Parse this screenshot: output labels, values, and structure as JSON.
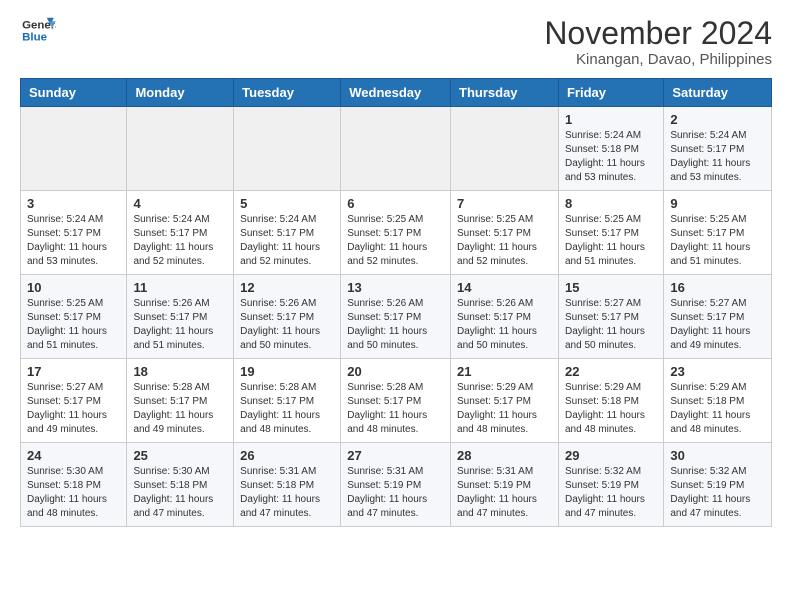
{
  "logo": {
    "line1": "General",
    "line2": "Blue"
  },
  "title": "November 2024",
  "subtitle": "Kinangan, Davao, Philippines",
  "days_of_week": [
    "Sunday",
    "Monday",
    "Tuesday",
    "Wednesday",
    "Thursday",
    "Friday",
    "Saturday"
  ],
  "weeks": [
    [
      {
        "day": "",
        "info": ""
      },
      {
        "day": "",
        "info": ""
      },
      {
        "day": "",
        "info": ""
      },
      {
        "day": "",
        "info": ""
      },
      {
        "day": "",
        "info": ""
      },
      {
        "day": "1",
        "info": "Sunrise: 5:24 AM\nSunset: 5:18 PM\nDaylight: 11 hours\nand 53 minutes."
      },
      {
        "day": "2",
        "info": "Sunrise: 5:24 AM\nSunset: 5:17 PM\nDaylight: 11 hours\nand 53 minutes."
      }
    ],
    [
      {
        "day": "3",
        "info": "Sunrise: 5:24 AM\nSunset: 5:17 PM\nDaylight: 11 hours\nand 53 minutes."
      },
      {
        "day": "4",
        "info": "Sunrise: 5:24 AM\nSunset: 5:17 PM\nDaylight: 11 hours\nand 52 minutes."
      },
      {
        "day": "5",
        "info": "Sunrise: 5:24 AM\nSunset: 5:17 PM\nDaylight: 11 hours\nand 52 minutes."
      },
      {
        "day": "6",
        "info": "Sunrise: 5:25 AM\nSunset: 5:17 PM\nDaylight: 11 hours\nand 52 minutes."
      },
      {
        "day": "7",
        "info": "Sunrise: 5:25 AM\nSunset: 5:17 PM\nDaylight: 11 hours\nand 52 minutes."
      },
      {
        "day": "8",
        "info": "Sunrise: 5:25 AM\nSunset: 5:17 PM\nDaylight: 11 hours\nand 51 minutes."
      },
      {
        "day": "9",
        "info": "Sunrise: 5:25 AM\nSunset: 5:17 PM\nDaylight: 11 hours\nand 51 minutes."
      }
    ],
    [
      {
        "day": "10",
        "info": "Sunrise: 5:25 AM\nSunset: 5:17 PM\nDaylight: 11 hours\nand 51 minutes."
      },
      {
        "day": "11",
        "info": "Sunrise: 5:26 AM\nSunset: 5:17 PM\nDaylight: 11 hours\nand 51 minutes."
      },
      {
        "day": "12",
        "info": "Sunrise: 5:26 AM\nSunset: 5:17 PM\nDaylight: 11 hours\nand 50 minutes."
      },
      {
        "day": "13",
        "info": "Sunrise: 5:26 AM\nSunset: 5:17 PM\nDaylight: 11 hours\nand 50 minutes."
      },
      {
        "day": "14",
        "info": "Sunrise: 5:26 AM\nSunset: 5:17 PM\nDaylight: 11 hours\nand 50 minutes."
      },
      {
        "day": "15",
        "info": "Sunrise: 5:27 AM\nSunset: 5:17 PM\nDaylight: 11 hours\nand 50 minutes."
      },
      {
        "day": "16",
        "info": "Sunrise: 5:27 AM\nSunset: 5:17 PM\nDaylight: 11 hours\nand 49 minutes."
      }
    ],
    [
      {
        "day": "17",
        "info": "Sunrise: 5:27 AM\nSunset: 5:17 PM\nDaylight: 11 hours\nand 49 minutes."
      },
      {
        "day": "18",
        "info": "Sunrise: 5:28 AM\nSunset: 5:17 PM\nDaylight: 11 hours\nand 49 minutes."
      },
      {
        "day": "19",
        "info": "Sunrise: 5:28 AM\nSunset: 5:17 PM\nDaylight: 11 hours\nand 48 minutes."
      },
      {
        "day": "20",
        "info": "Sunrise: 5:28 AM\nSunset: 5:17 PM\nDaylight: 11 hours\nand 48 minutes."
      },
      {
        "day": "21",
        "info": "Sunrise: 5:29 AM\nSunset: 5:17 PM\nDaylight: 11 hours\nand 48 minutes."
      },
      {
        "day": "22",
        "info": "Sunrise: 5:29 AM\nSunset: 5:18 PM\nDaylight: 11 hours\nand 48 minutes."
      },
      {
        "day": "23",
        "info": "Sunrise: 5:29 AM\nSunset: 5:18 PM\nDaylight: 11 hours\nand 48 minutes."
      }
    ],
    [
      {
        "day": "24",
        "info": "Sunrise: 5:30 AM\nSunset: 5:18 PM\nDaylight: 11 hours\nand 48 minutes."
      },
      {
        "day": "25",
        "info": "Sunrise: 5:30 AM\nSunset: 5:18 PM\nDaylight: 11 hours\nand 47 minutes."
      },
      {
        "day": "26",
        "info": "Sunrise: 5:31 AM\nSunset: 5:18 PM\nDaylight: 11 hours\nand 47 minutes."
      },
      {
        "day": "27",
        "info": "Sunrise: 5:31 AM\nSunset: 5:19 PM\nDaylight: 11 hours\nand 47 minutes."
      },
      {
        "day": "28",
        "info": "Sunrise: 5:31 AM\nSunset: 5:19 PM\nDaylight: 11 hours\nand 47 minutes."
      },
      {
        "day": "29",
        "info": "Sunrise: 5:32 AM\nSunset: 5:19 PM\nDaylight: 11 hours\nand 47 minutes."
      },
      {
        "day": "30",
        "info": "Sunrise: 5:32 AM\nSunset: 5:19 PM\nDaylight: 11 hours\nand 47 minutes."
      }
    ]
  ]
}
